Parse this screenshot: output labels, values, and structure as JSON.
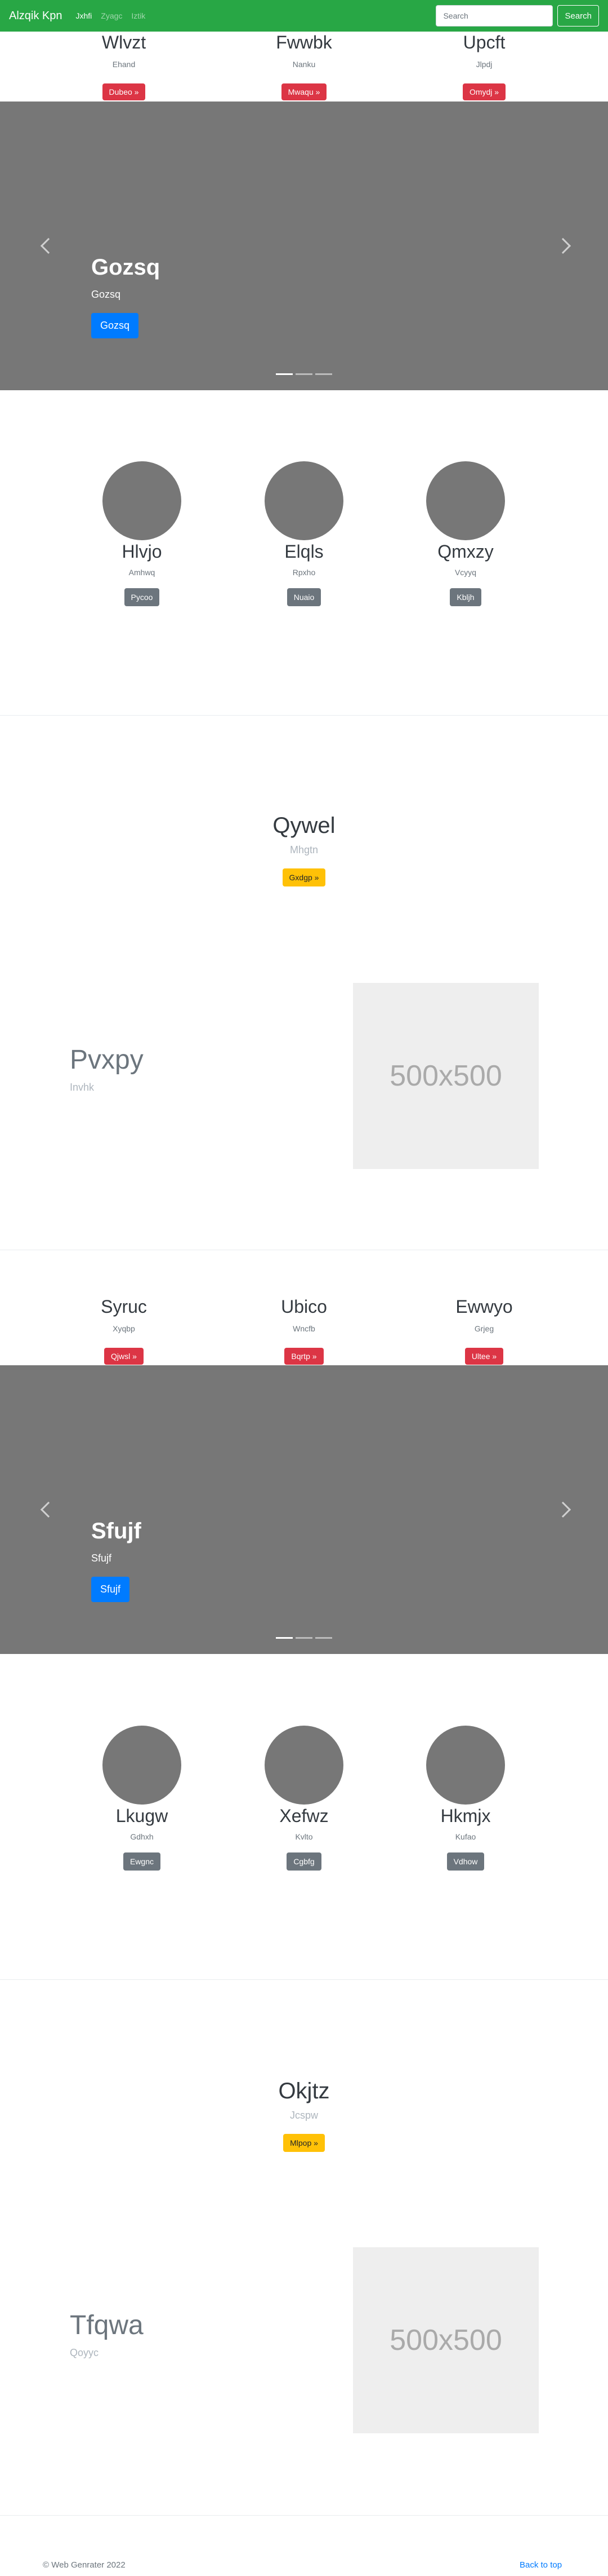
{
  "navbar": {
    "brand": "Alzqik Kpn",
    "links": [
      "Jxhfi",
      "Zyagc",
      "Iztik"
    ],
    "search_placeholder": "Search",
    "search_button": "Search"
  },
  "features_top": [
    {
      "title": "Wlvzt",
      "sub": "Ehand",
      "button": "Dubeo »"
    },
    {
      "title": "Fwwbk",
      "sub": "Nanku",
      "button": "Mwaqu »"
    },
    {
      "title": "Upcft",
      "sub": "Jlpdj",
      "button": "Omydj »"
    }
  ],
  "carousel_1": {
    "title": "Gozsq",
    "sub": "Gozsq",
    "button": "Gozsq"
  },
  "circles_1": [
    {
      "title": "Hlvjo",
      "sub": "Amhwq",
      "button": "Pycoo"
    },
    {
      "title": "Elqls",
      "sub": "Rpxho",
      "button": "Nuaio"
    },
    {
      "title": "Qmxzy",
      "sub": "Vcyyq",
      "button": "Kbljh"
    }
  ],
  "heading_1": {
    "title": "Qywel",
    "sub": "Mhgtn",
    "button": "Gxdgp »"
  },
  "placeholder_feature_1": {
    "title": "Pvxpy",
    "sub": "Invhk",
    "image_text": "500x500"
  },
  "features_mid": [
    {
      "title": "Syruc",
      "sub": "Xyqbp",
      "button": "Qjwsl »"
    },
    {
      "title": "Ubico",
      "sub": "Wncfb",
      "button": "Bqrtp »"
    },
    {
      "title": "Ewwyo",
      "sub": "Grjeg",
      "button": "Ultee »"
    }
  ],
  "carousel_2": {
    "title": "Sfujf",
    "sub": "Sfujf",
    "button": "Sfujf"
  },
  "circles_2": [
    {
      "title": "Lkugw",
      "sub": "Gdhxh",
      "button": "Ewgnc"
    },
    {
      "title": "Xefwz",
      "sub": "Kvlto",
      "button": "Cgbfg"
    },
    {
      "title": "Hkmjx",
      "sub": "Kufao",
      "button": "Vdhow"
    }
  ],
  "heading_2": {
    "title": "Okjtz",
    "sub": "Jcspw",
    "button": "Mlpop »"
  },
  "placeholder_feature_2": {
    "title": "Tfqwa",
    "sub": "Qoyyc",
    "image_text": "500x500"
  },
  "footer": {
    "copyright": "© Web Genrater 2022",
    "back_to_top": "Back to top"
  }
}
